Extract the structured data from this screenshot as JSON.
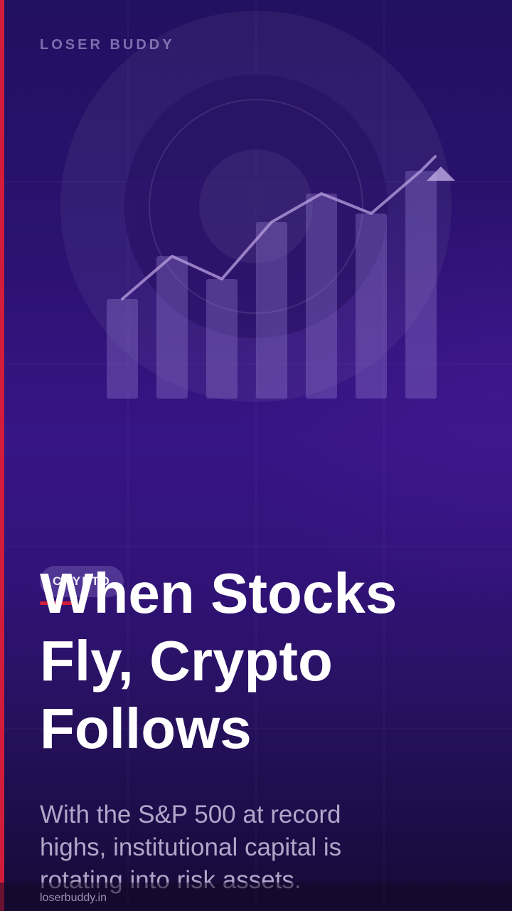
{
  "brand": {
    "name": "LOSER BUDDY"
  },
  "category_tag": {
    "label": "CRYPTO"
  },
  "headline": {
    "text": "When Stocks Fly, Crypto Follows"
  },
  "subtext": {
    "text": "With the S&P 500 at record highs, institutional capital is rotating into risk assets."
  },
  "footer": {
    "url": "loserbuddy.in"
  },
  "illustration": {
    "icon": "rising-bar-line-chart-icon",
    "bar_levels": [
      0.35,
      0.5,
      0.42,
      0.62,
      0.72,
      0.65,
      0.8
    ],
    "trend_levels": [
      0.35,
      0.5,
      0.42,
      0.62,
      0.72,
      0.65,
      0.8
    ],
    "trend_direction": "up"
  },
  "colors": {
    "accent": "#d21c3c",
    "background_top": "#221060",
    "background_mid": "#371585",
    "background_bottom": "#160a36",
    "text": "#ffffff"
  }
}
